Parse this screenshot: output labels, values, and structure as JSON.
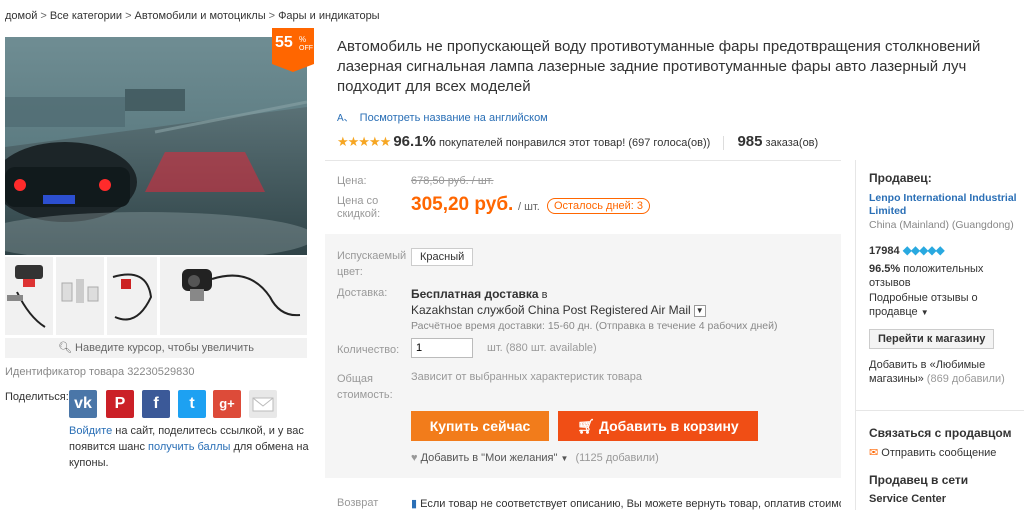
{
  "breadcrumb": [
    "домой",
    "Все категории",
    "Автомобили и мотоциклы",
    "Фары и индикаторы"
  ],
  "breadcrumb_sep": ">",
  "badge": {
    "percent": "55",
    "percent_sign": "%",
    "off": "OFF"
  },
  "gallery": {
    "zoom_hint": "Наведите курсор, чтобы увеличить",
    "product_id": "Идентификатор товара 32230529830"
  },
  "share": {
    "label": "Поделиться:",
    "icons": [
      "vk-icon",
      "pinterest-icon",
      "facebook-icon",
      "twitter-icon",
      "googleplus-icon",
      "email-icon"
    ],
    "text_link1": "Войдите",
    "text_mid": " на сайт, поделитесь ссылкой, и у вас появится шанс ",
    "text_link2": "получить баллы",
    "text_end": " для обмена на купоны."
  },
  "product": {
    "title": "Автомобиль не пропускающей воду противотуманные фары предотвращения столкновений лазерная сигнальная лампа лазерные задние противотуманные фары авто лазерный луч подходит для всех моделей",
    "translate_link": "Посмотреть название на английском",
    "rating_pct": "96.1%",
    "rating_text": "покупателей понравился этот товар! (697 голоса(ов))",
    "orders_count": "985",
    "orders_label": "заказа(ов)"
  },
  "price": {
    "price_label": "Цена:",
    "old_price": "678,50 руб. / шт.",
    "discount_label": "Цена со скидкой:",
    "new_price": "305,20 руб.",
    "unit": "/ шт.",
    "days_left": "Осталось дней: 3"
  },
  "options": {
    "color_label": "Испускаемый цвет:",
    "color_value": "Красный",
    "shipping_label": "Доставка:",
    "shipping_free": "Бесплатная доставка",
    "shipping_to": "в",
    "shipping_method": "Kazakhstan службой China Post Registered Air Mail",
    "shipping_time": "Расчётное время доставки: 15-60 дн. (Отправка в течение 4 рабочих дней)",
    "qty_label": "Количество:",
    "qty_value": "1",
    "qty_avail": "шт. (880 шт. available)",
    "total_label": "Общая стоимость:",
    "total_value": "Зависит от выбранных характеристик товара",
    "buy_now": "Купить сейчас",
    "add_cart": "Добавить в корзину",
    "wishlist": "Добавить в \"Мои желания\"",
    "wishlist_count": "(1125 добавили)",
    "return_label": "Возврат",
    "return_text": "Если товар не соответствует описанию, Вы можете вернуть товар, оплатив стоимость"
  },
  "seller": {
    "heading": "Продавец:",
    "store_name": "Lenpo International Industrial Limited",
    "location": "China (Mainland) (Guangdong)",
    "score": "17984",
    "feedback_pct": "96.5%",
    "feedback_text": "положительных отзывов",
    "detail_link": "Подробные отзывы о продавце",
    "store_button": "Перейти к магазину",
    "fav_text": "Добавить в «Любимые магазины»",
    "fav_count": "(869 добавили)",
    "contact_heading": "Связаться с продавцом",
    "send_message": "Отправить сообщение",
    "online_heading": "Продавец в сети",
    "service_center": "Service Center"
  },
  "colors": {
    "accent": "#f60",
    "buy": "#f27c1b",
    "cart": "#f04e15",
    "link": "#2a6fb6",
    "star": "#f6a623"
  }
}
